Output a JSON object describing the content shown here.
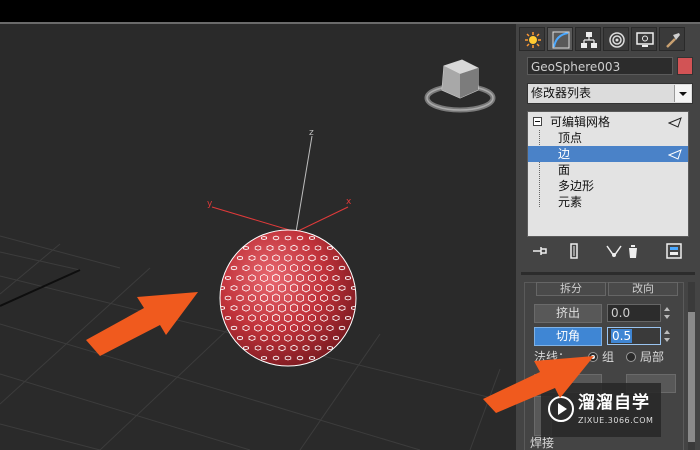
{
  "object_name": "GeoSphere003",
  "colors": {
    "object_color": "#d25355",
    "selection_blue": "#4a82c8",
    "annotation_arrow": "#f05a1e",
    "sphere_red": "#c0323a"
  },
  "command_tabs": [
    {
      "icon": "create-icon"
    },
    {
      "icon": "modify-icon",
      "active": true
    },
    {
      "icon": "hierarchy-icon"
    },
    {
      "icon": "motion-icon"
    },
    {
      "icon": "display-icon"
    },
    {
      "icon": "utilities-icon"
    }
  ],
  "modifier_list": "修改器列表",
  "stack": {
    "root": "可编辑网格",
    "items": [
      "顶点",
      "边",
      "面",
      "多边形",
      "元素"
    ],
    "selected": "边"
  },
  "stack_tools": [
    "pin-stack-icon",
    "show-end-result-icon",
    "make-unique-icon",
    "remove-modifier-icon",
    "configure-sets-icon"
  ],
  "edit_geometry": {
    "top_buttons": [
      "拆分",
      "改向"
    ],
    "extrude_label": "挤出",
    "extrude_value": "0.0",
    "chamfer_label": "切角",
    "chamfer_value": "0.5",
    "normals_label": "法线：",
    "group_label": "组",
    "local_label": "局部",
    "normals_selected": "组",
    "bottom_label": "焊接"
  },
  "viewport_axes": {
    "x": "x",
    "y": "y",
    "z": "z"
  },
  "watermark": {
    "title": "溜溜自学",
    "url": "ZIXUE.3066.COM"
  }
}
